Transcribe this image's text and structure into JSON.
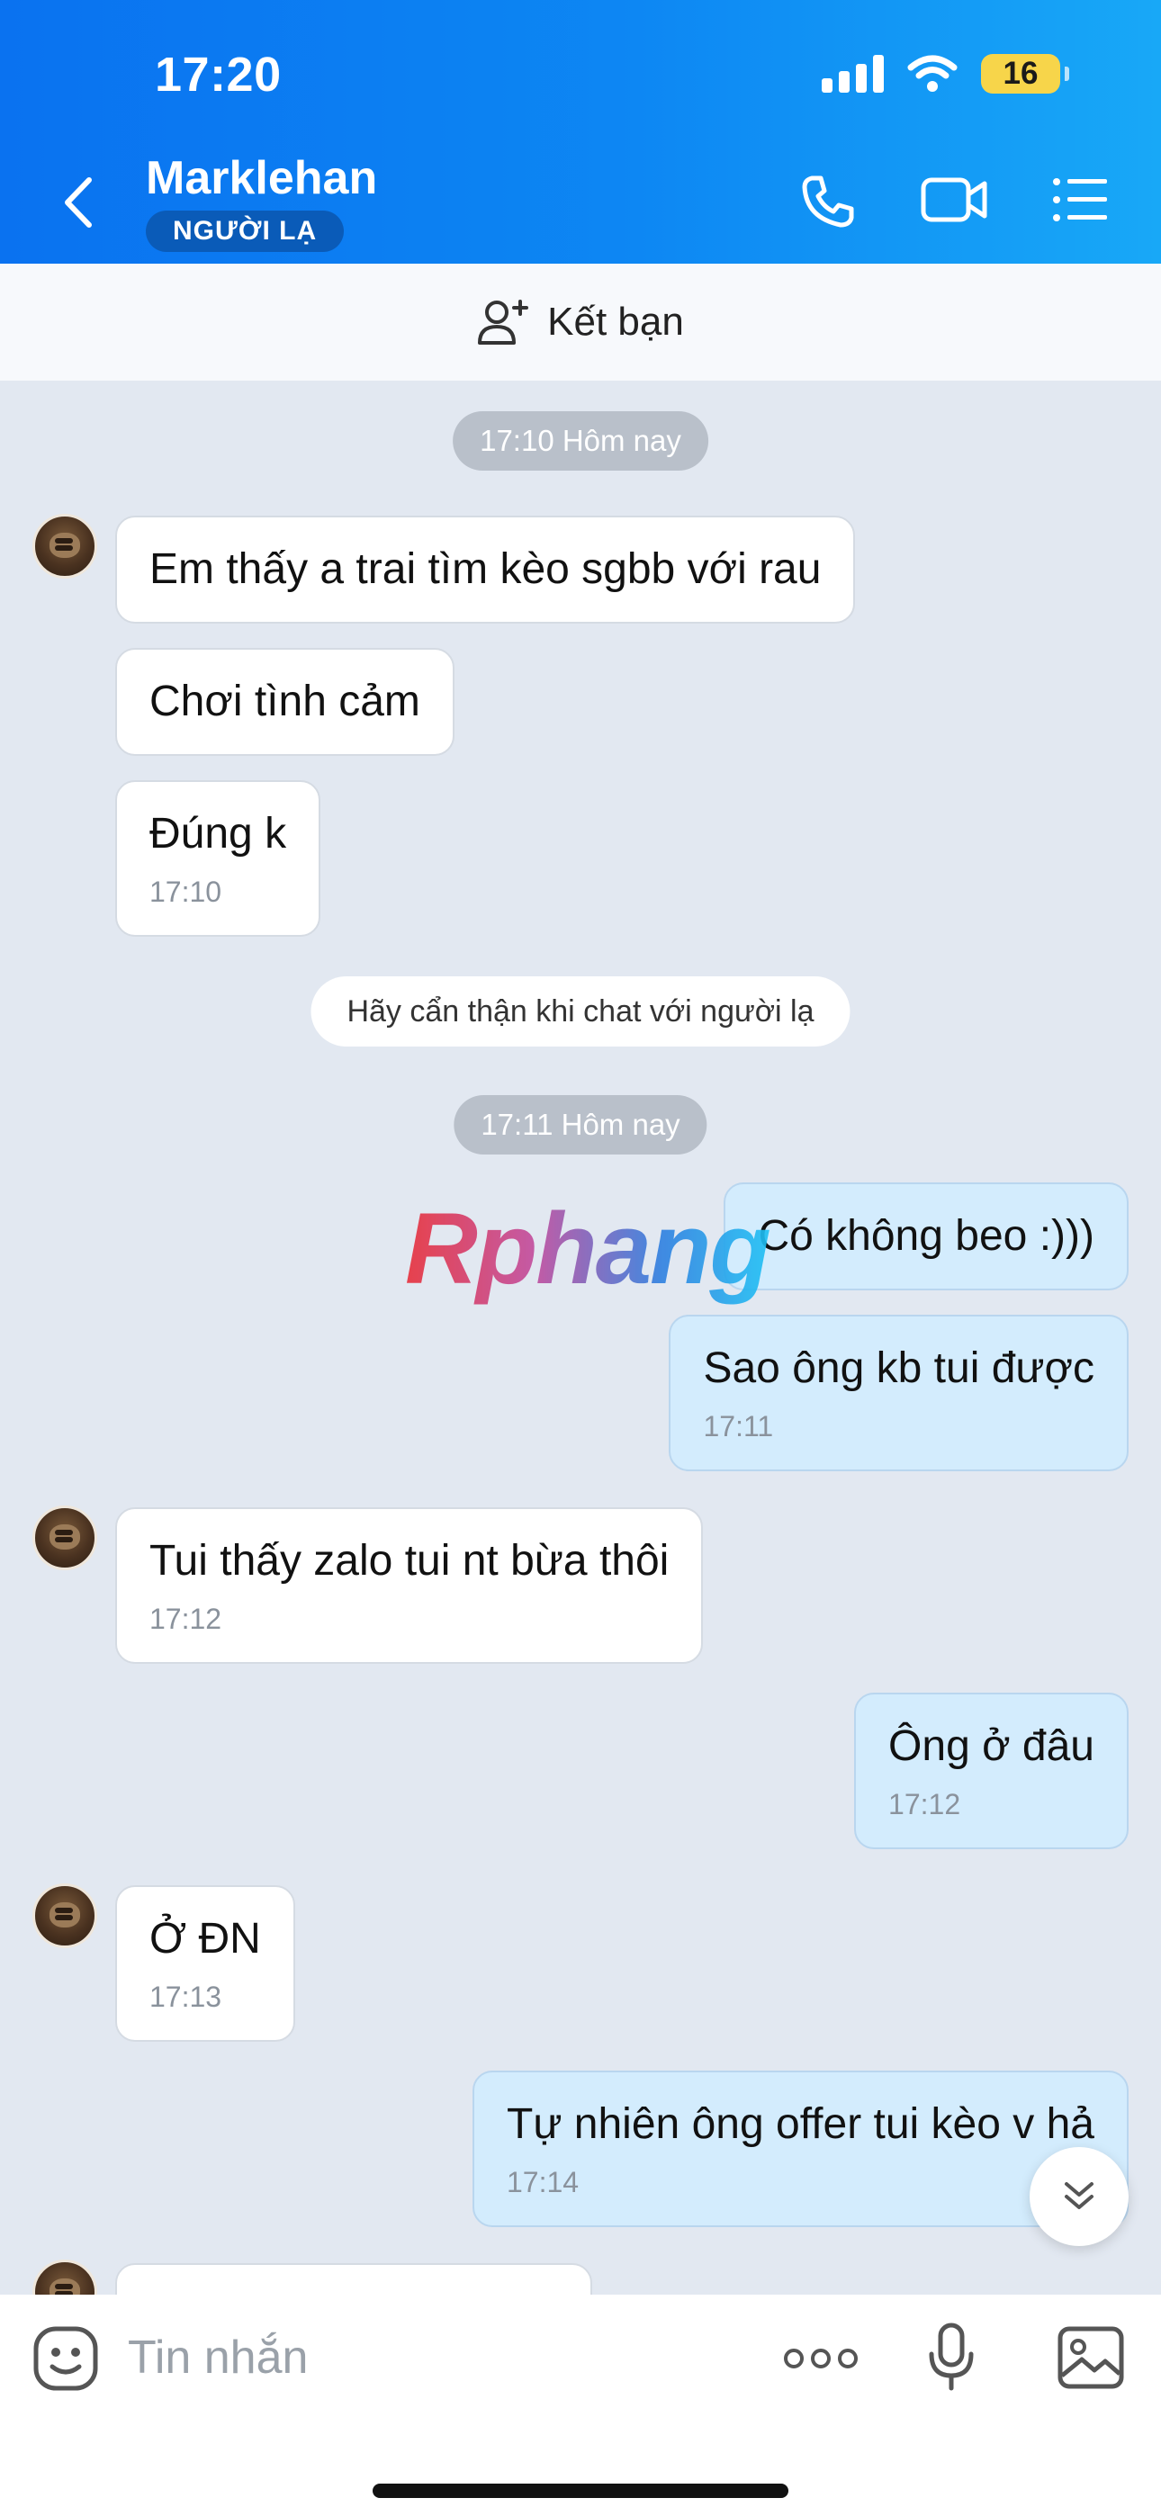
{
  "status_bar": {
    "time": "17:20",
    "battery": "16"
  },
  "header": {
    "contact_name": "Marklehan",
    "badge": "NGƯỜI LẠ",
    "icons": [
      "back-icon",
      "phone-icon",
      "video-icon",
      "menu-list-icon"
    ]
  },
  "add_friend": {
    "label": "Kết bạn",
    "icon": "add-user-icon"
  },
  "chat": {
    "pill_1": "17:10 Hôm nay",
    "pill_2": "17:11 Hôm nay",
    "warning": "Hãy cẩn thận khi chat với người lạ",
    "messages": [
      {
        "dir": "in",
        "text": "Em thấy a trai tìm kèo sgbb với rau",
        "time": ""
      },
      {
        "dir": "in",
        "text": "Chơi tình cảm",
        "time": ""
      },
      {
        "dir": "in",
        "text": "Đúng k",
        "time": "17:10"
      },
      {
        "dir": "out",
        "text": "Có không beo :)))",
        "time": ""
      },
      {
        "dir": "out",
        "text": "Sao ông kb tui được",
        "time": "17:11"
      },
      {
        "dir": "in",
        "text": "Tui thấy zalo tui nt bừa thôi",
        "time": "17:12"
      },
      {
        "dir": "out",
        "text": "Ông ở đâu",
        "time": "17:12"
      },
      {
        "dir": "in",
        "text": "Ở ĐN",
        "time": "17:13"
      },
      {
        "dir": "out",
        "text": "Tự nhiên ông offer tui kèo v hả",
        "time": "17:14"
      }
    ],
    "watermark": "Rphang"
  },
  "input": {
    "placeholder": "Tin nhắn",
    "icons": [
      "emoji-icon",
      "more-icon",
      "microphone-icon",
      "image-icon"
    ]
  },
  "colors": {
    "header_start": "#0a72f0",
    "header_end": "#18a8f7",
    "out_bubble": "#d3ecfd",
    "chat_bg": "#e2e8f1"
  }
}
